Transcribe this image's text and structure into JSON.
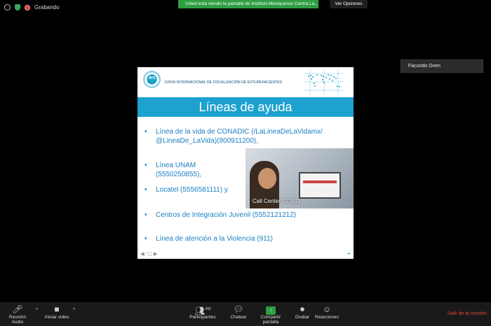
{
  "top": {
    "recording_label": "Grabando"
  },
  "share_banner": {
    "text": "Usted está viendo la pantalla de Instituto Mexiquense Contra La...",
    "view_options": "Ver Opciones"
  },
  "participant": {
    "name": "Facundo Oven"
  },
  "slide": {
    "logo_text": "JIFE",
    "org_name": "JUNTA INTERNACIONAL DE FISCALIZACIÓN DE ESTUPEFACIENTES",
    "title": "Líneas de ayuda",
    "bullets": [
      "Línea de la vida de CONADIC (/LaLineaDeLaVidamx/ @LineaDe_LaVida)(800911200),",
      "Línea UNAM (5550250855),",
      "Locatel (5556581111) y",
      "Centros de Integración Juvenil (5552121212)",
      "Línea de atención a la Violencia (911)"
    ],
    "bullet_glyph": "•",
    "photo_caption": "Call Center COVID",
    "nav": "◀ ⁄ ▢ ▶",
    "corner": "⯮"
  },
  "toolbar": {
    "audio_label": "Reunión Audio",
    "video_label": "Iniciar video",
    "participants_label": "Participantes",
    "participants_count": "499",
    "chat_label": "Chatear",
    "share_label": "Compartir pantalla",
    "record_label": "Grabar",
    "reactions_label": "Reacciones",
    "leave_label": "Salir de la reunión"
  },
  "colors": {
    "share_green": "#2e9e43",
    "leave_red": "#e0413b",
    "slide_title_bar": "#1da1d0",
    "slide_text": "#1a7fc4"
  }
}
